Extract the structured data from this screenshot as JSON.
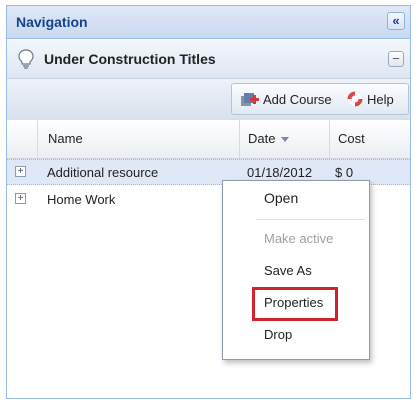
{
  "nav": {
    "title": "Navigation",
    "collapse_glyph": "«"
  },
  "panel": {
    "title": "Under Construction Titles",
    "collapse_glyph": "−",
    "icon": "lightbulb-icon"
  },
  "toolbar": {
    "add_course_label": "Add Course",
    "help_label": "Help"
  },
  "grid": {
    "columns": [
      "Name",
      "Date",
      "Cost"
    ],
    "rows": [
      {
        "name": "Additional resource",
        "date": "01/18/2012",
        "cost": "$ 0"
      },
      {
        "name": "Home Work",
        "date": "",
        "cost": ""
      }
    ]
  },
  "context_menu": {
    "items": [
      {
        "label": "Open",
        "enabled": true
      },
      {
        "label": "Make active",
        "enabled": false
      },
      {
        "label": "Save As",
        "enabled": true
      },
      {
        "label": "Properties",
        "enabled": true,
        "highlighted": true
      },
      {
        "label": "Drop",
        "enabled": true
      }
    ]
  },
  "colors": {
    "header_text": "#15428b",
    "highlight": "#d42330",
    "selection": "#dfe8f6"
  }
}
